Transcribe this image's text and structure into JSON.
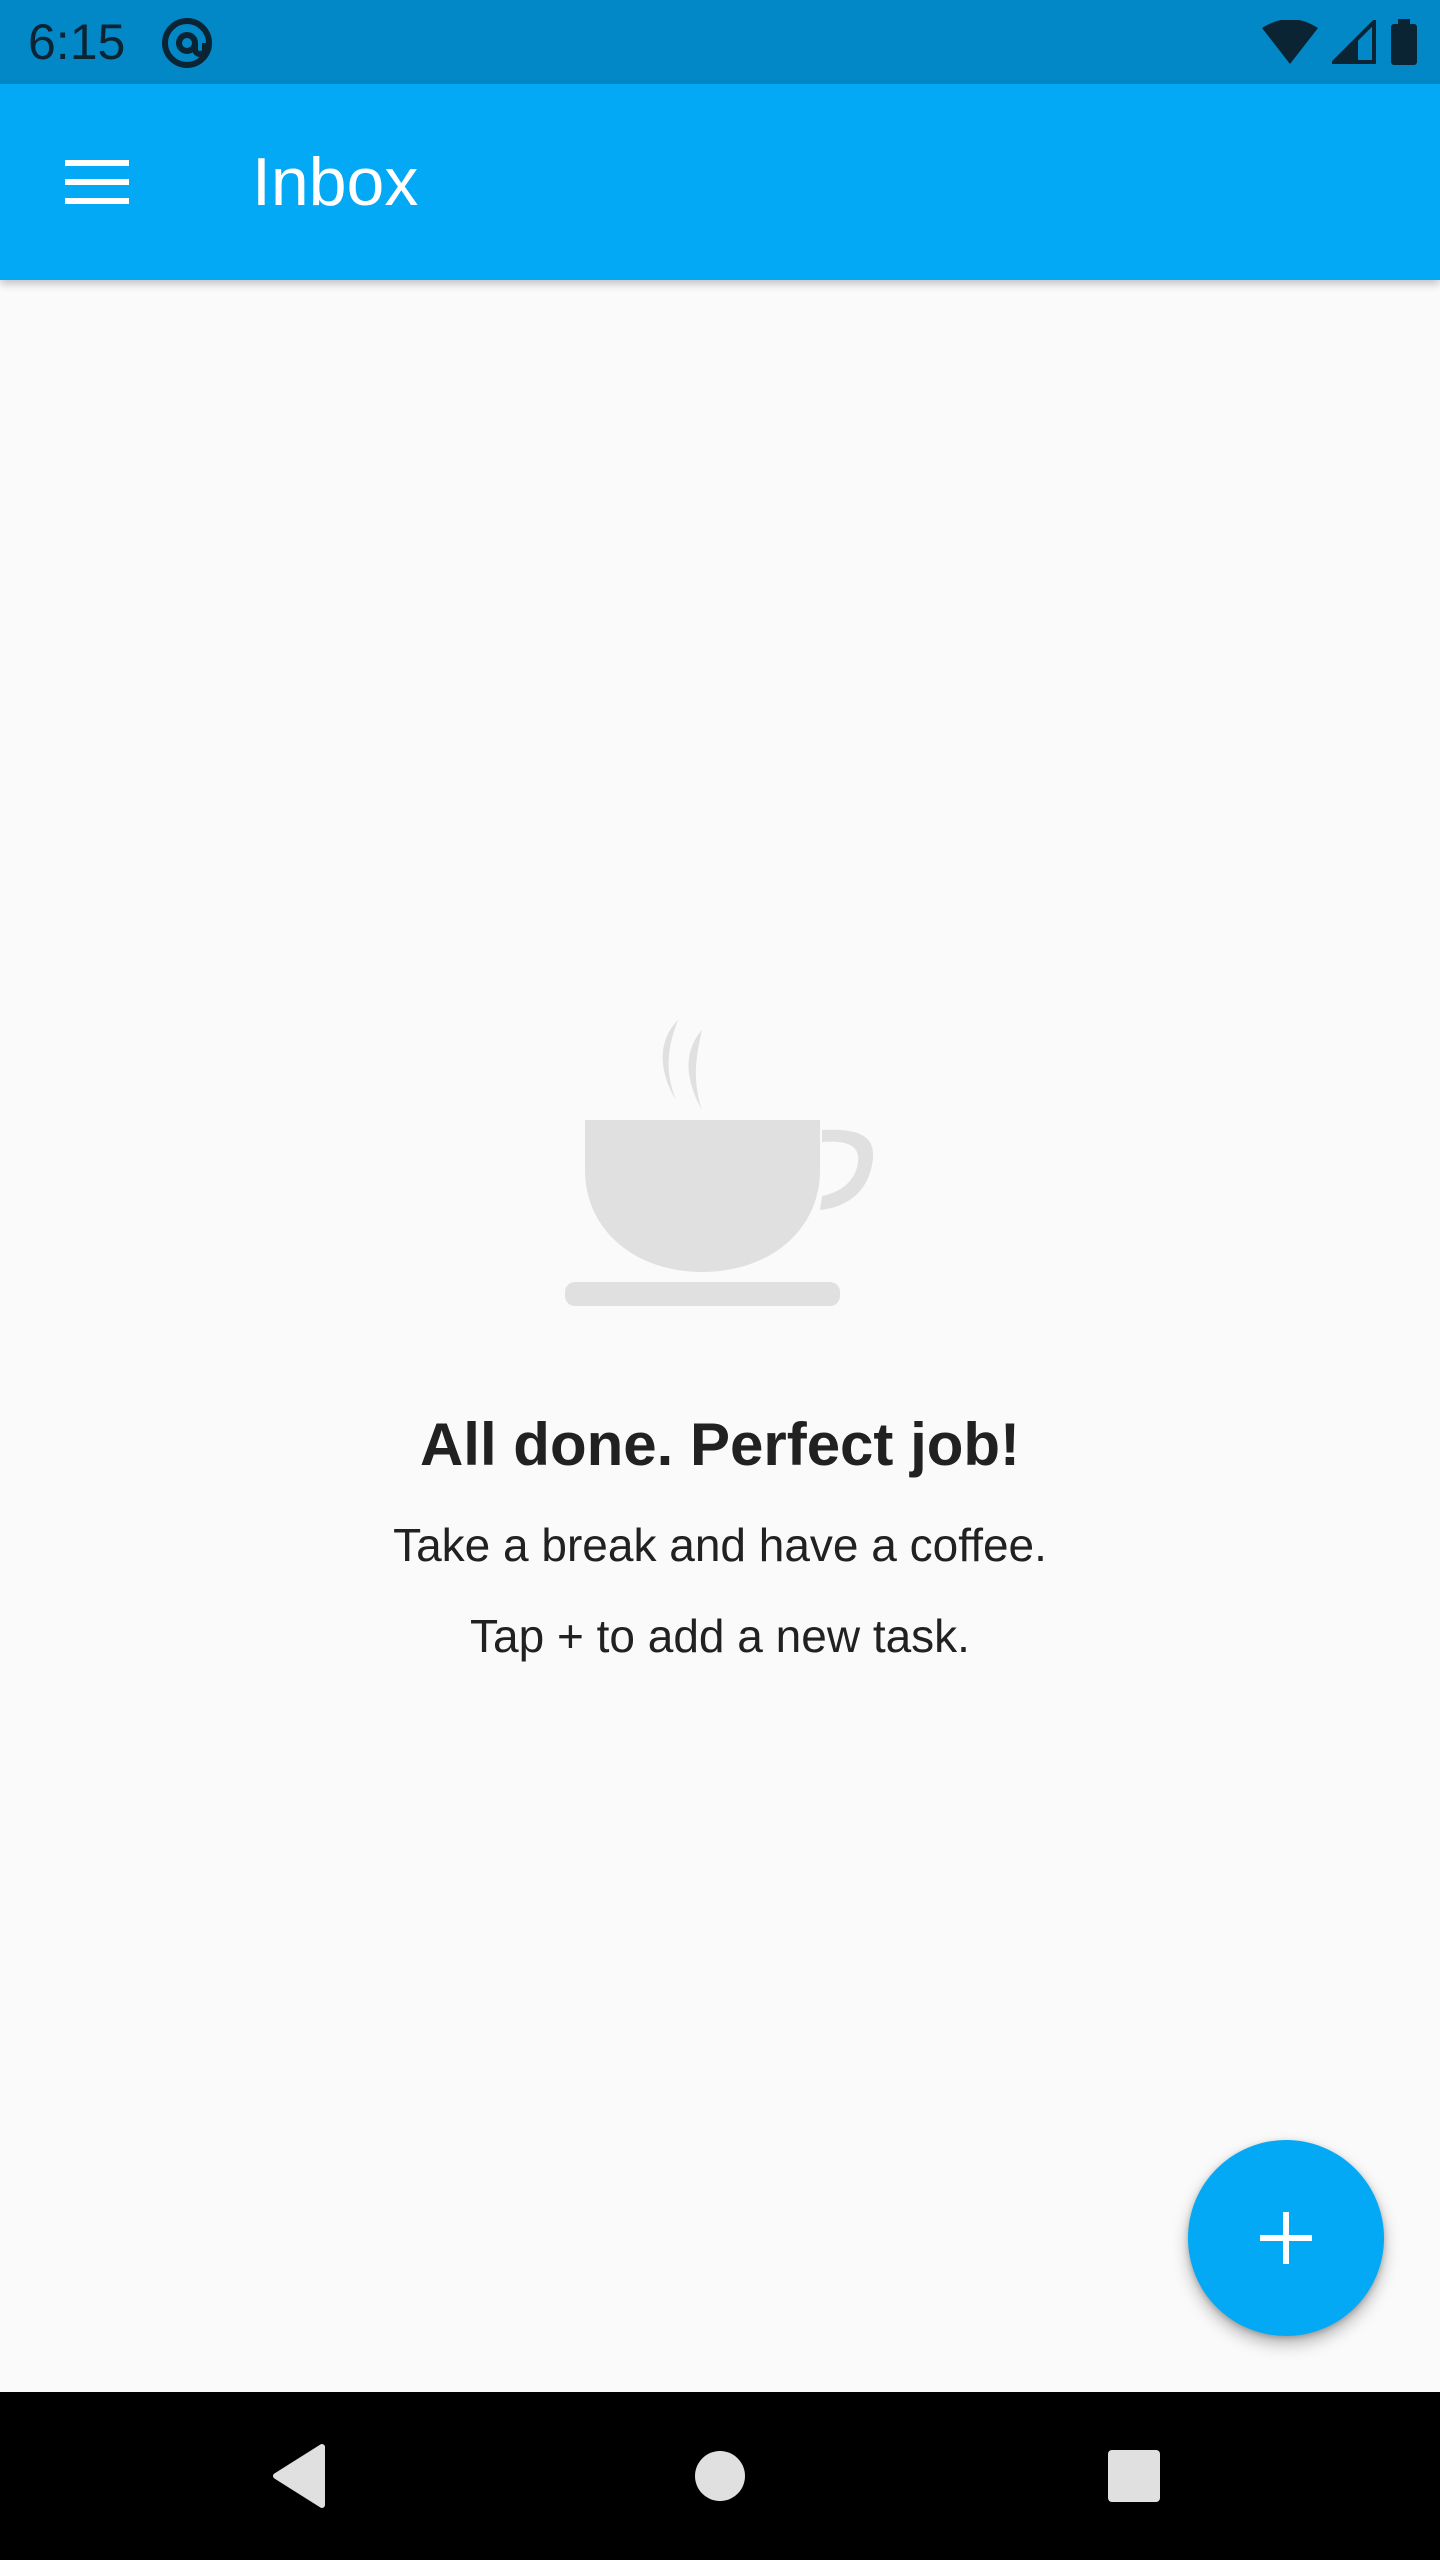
{
  "status_bar": {
    "time": "6:15",
    "icons": [
      "at-sign-icon",
      "wifi-icon",
      "cell-signal-icon",
      "battery-icon"
    ]
  },
  "app_bar": {
    "title": "Inbox",
    "menu_icon": "hamburger-menu-icon",
    "color": "#03a9f4"
  },
  "empty_state": {
    "icon": "coffee-cup-icon",
    "title": "All done. Perfect job!",
    "line1": "Take a break and have a coffee.",
    "line2": "Tap + to add a new task."
  },
  "fab": {
    "icon": "plus-icon",
    "color": "#03a9f4"
  },
  "nav_bar": {
    "buttons": [
      "back-icon",
      "home-icon",
      "recents-icon"
    ]
  }
}
